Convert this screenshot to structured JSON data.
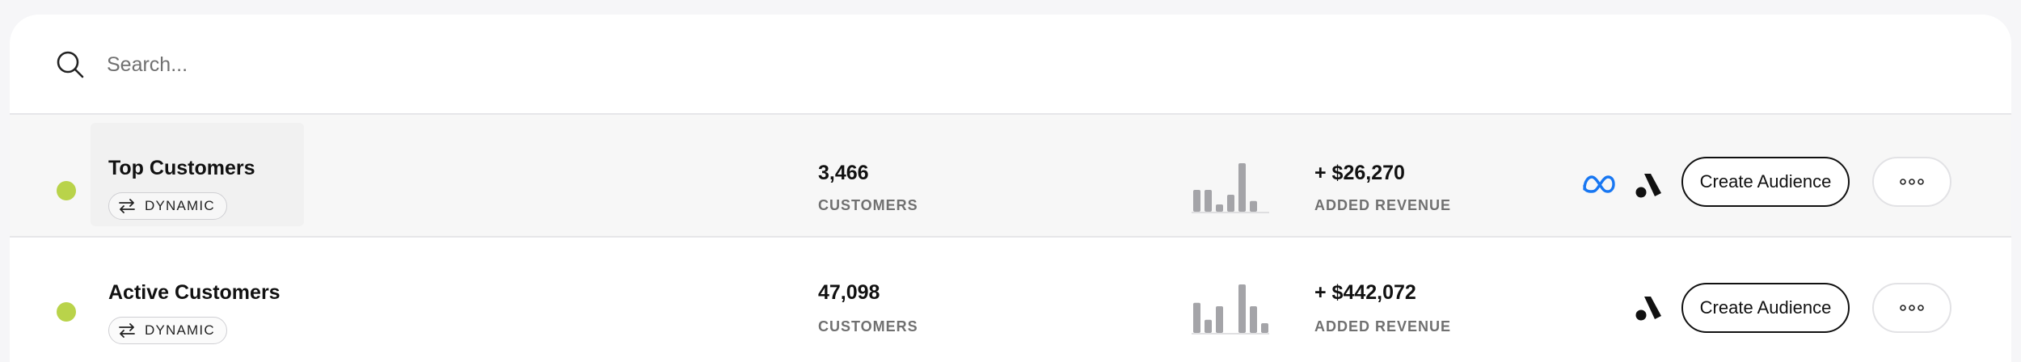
{
  "search": {
    "placeholder": "Search..."
  },
  "colors": {
    "status_active": "#b9d34a",
    "meta_blue": "#1877f2",
    "spark_bar": "#a4a4a8"
  },
  "audiences": [
    {
      "name": "Top Customers",
      "status_color": "#b9d34a",
      "type_badge": "DYNAMIC",
      "customers_value": "3,466",
      "customers_label": "CUSTOMERS",
      "revenue_value": "+ $26,270",
      "revenue_label": "ADDED REVENUE",
      "sparkline": [
        0.45,
        0.45,
        0.15,
        0.35,
        1.0,
        0.22
      ],
      "integrations": [
        "meta-icon",
        "a-icon"
      ],
      "create_label": "Create Audience",
      "more_icon": "more-dots-icon"
    },
    {
      "name": "Active Customers",
      "status_color": "#b9d34a",
      "type_badge": "DYNAMIC",
      "customers_value": "47,098",
      "customers_label": "CUSTOMERS",
      "revenue_value": "+ $442,072",
      "revenue_label": "ADDED REVENUE",
      "sparkline": [
        0.62,
        0.27,
        0.55,
        0.0,
        1.0,
        0.55,
        0.2
      ],
      "integrations": [
        "a-icon"
      ],
      "create_label": "Create Audience",
      "more_icon": "more-dots-icon"
    }
  ]
}
